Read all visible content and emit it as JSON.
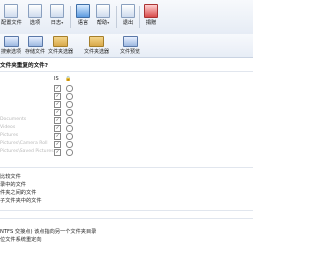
{
  "toolbar": {
    "items": [
      {
        "label": "配置文件",
        "icon": "profile-icon"
      },
      {
        "label": "选项",
        "icon": "options-icon"
      },
      {
        "label": "日志",
        "icon": "log-icon",
        "dropdown": "▾"
      },
      {
        "label": "语言",
        "icon": "language-icon"
      },
      {
        "label": "帮助",
        "icon": "help-icon",
        "dropdown": "▾"
      },
      {
        "label": "退出",
        "icon": "exit-icon"
      },
      {
        "label": "捐赠",
        "icon": "donate-icon"
      }
    ]
  },
  "toolbar2": {
    "items": [
      {
        "label": "搜索选项",
        "icon": "search-options-icon"
      },
      {
        "label": "存储文件",
        "icon": "save-file-icon"
      },
      {
        "label": "文件夹选器",
        "icon": "folder-selector-icon"
      },
      {
        "label": "文件夹选器",
        "icon": "folder-selector-icon"
      },
      {
        "label": "文件预览",
        "icon": "file-preview-icon"
      }
    ]
  },
  "main": {
    "heading": "文件夹重复的文件?",
    "col_headers": [
      "IS",
      "🔒"
    ],
    "rows": [
      {
        "name": ""
      },
      {
        "name": ""
      },
      {
        "name": ""
      },
      {
        "name": ""
      },
      {
        "name": "Documents"
      },
      {
        "name": "Videos"
      },
      {
        "name": "Pictures"
      },
      {
        "name": "Pictures\\Camera Roll"
      },
      {
        "name": "Pictures\\Saved Pictures"
      }
    ],
    "check_mark": "✓",
    "options1": [
      "比较文件",
      "录中的文件",
      "件夹之间的文件",
      "子文件夹中的文件"
    ],
    "options2": [
      "NTFS 交接点) 该点指向另一个文件夹目录",
      "位文件系统重定向"
    ]
  }
}
